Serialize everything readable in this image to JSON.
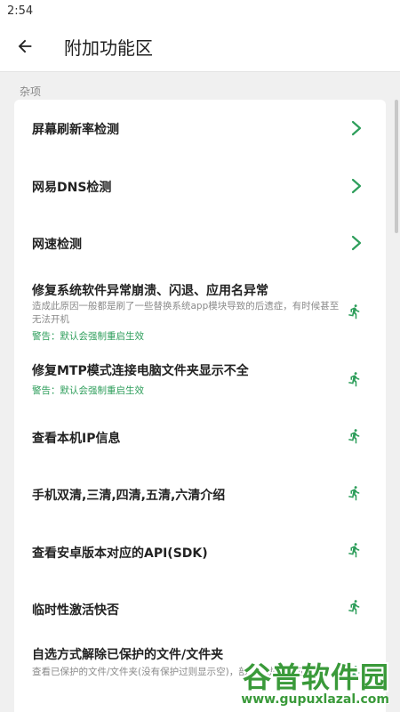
{
  "status_bar": {
    "time": "2:54"
  },
  "app_bar": {
    "title": "附加功能区"
  },
  "section": {
    "label": "杂项"
  },
  "items": [
    {
      "title": "屏幕刷新率检测",
      "action_icon": "chevron-right-icon"
    },
    {
      "title": "网易DNS检测",
      "action_icon": "chevron-right-icon"
    },
    {
      "title": "网速检测",
      "action_icon": "chevron-right-icon"
    },
    {
      "title": "修复系统软件异常崩溃、闪退、应用名异常",
      "description": "造成此原因一般都是刷了一些替换系统app模块导致的后遗症，有时候甚至无法开机",
      "warning": "警告：默认会强制重启生效",
      "action_icon": "run-icon"
    },
    {
      "title": "修复MTP模式连接电脑文件夹显示不全",
      "warning": "警告：默认会强制重启生效",
      "action_icon": "run-icon"
    },
    {
      "title": "查看本机IP信息",
      "action_icon": "run-icon"
    },
    {
      "title": "手机双清,三清,四清,五清,六清介绍",
      "action_icon": "run-icon"
    },
    {
      "title": "查看安卓版本对应的API(SDK)",
      "action_icon": "run-icon"
    },
    {
      "title": "临时性激活快否",
      "action_icon": "run-icon"
    },
    {
      "title": "自选方式解除已保护的文件/文件夹",
      "description": "查看已保护的文件/文件夹(没有保护过则显示空)，部，点执行即可恢复",
      "action_icon": "run-icon"
    }
  ],
  "watermark": {
    "brand": "谷普软件园",
    "url": "www.gupuxlazal.com"
  },
  "colors": {
    "accent": "#2e9e5b",
    "chevron": "#2e9e5b",
    "background": "#f0f0f0",
    "card": "#ffffff"
  }
}
